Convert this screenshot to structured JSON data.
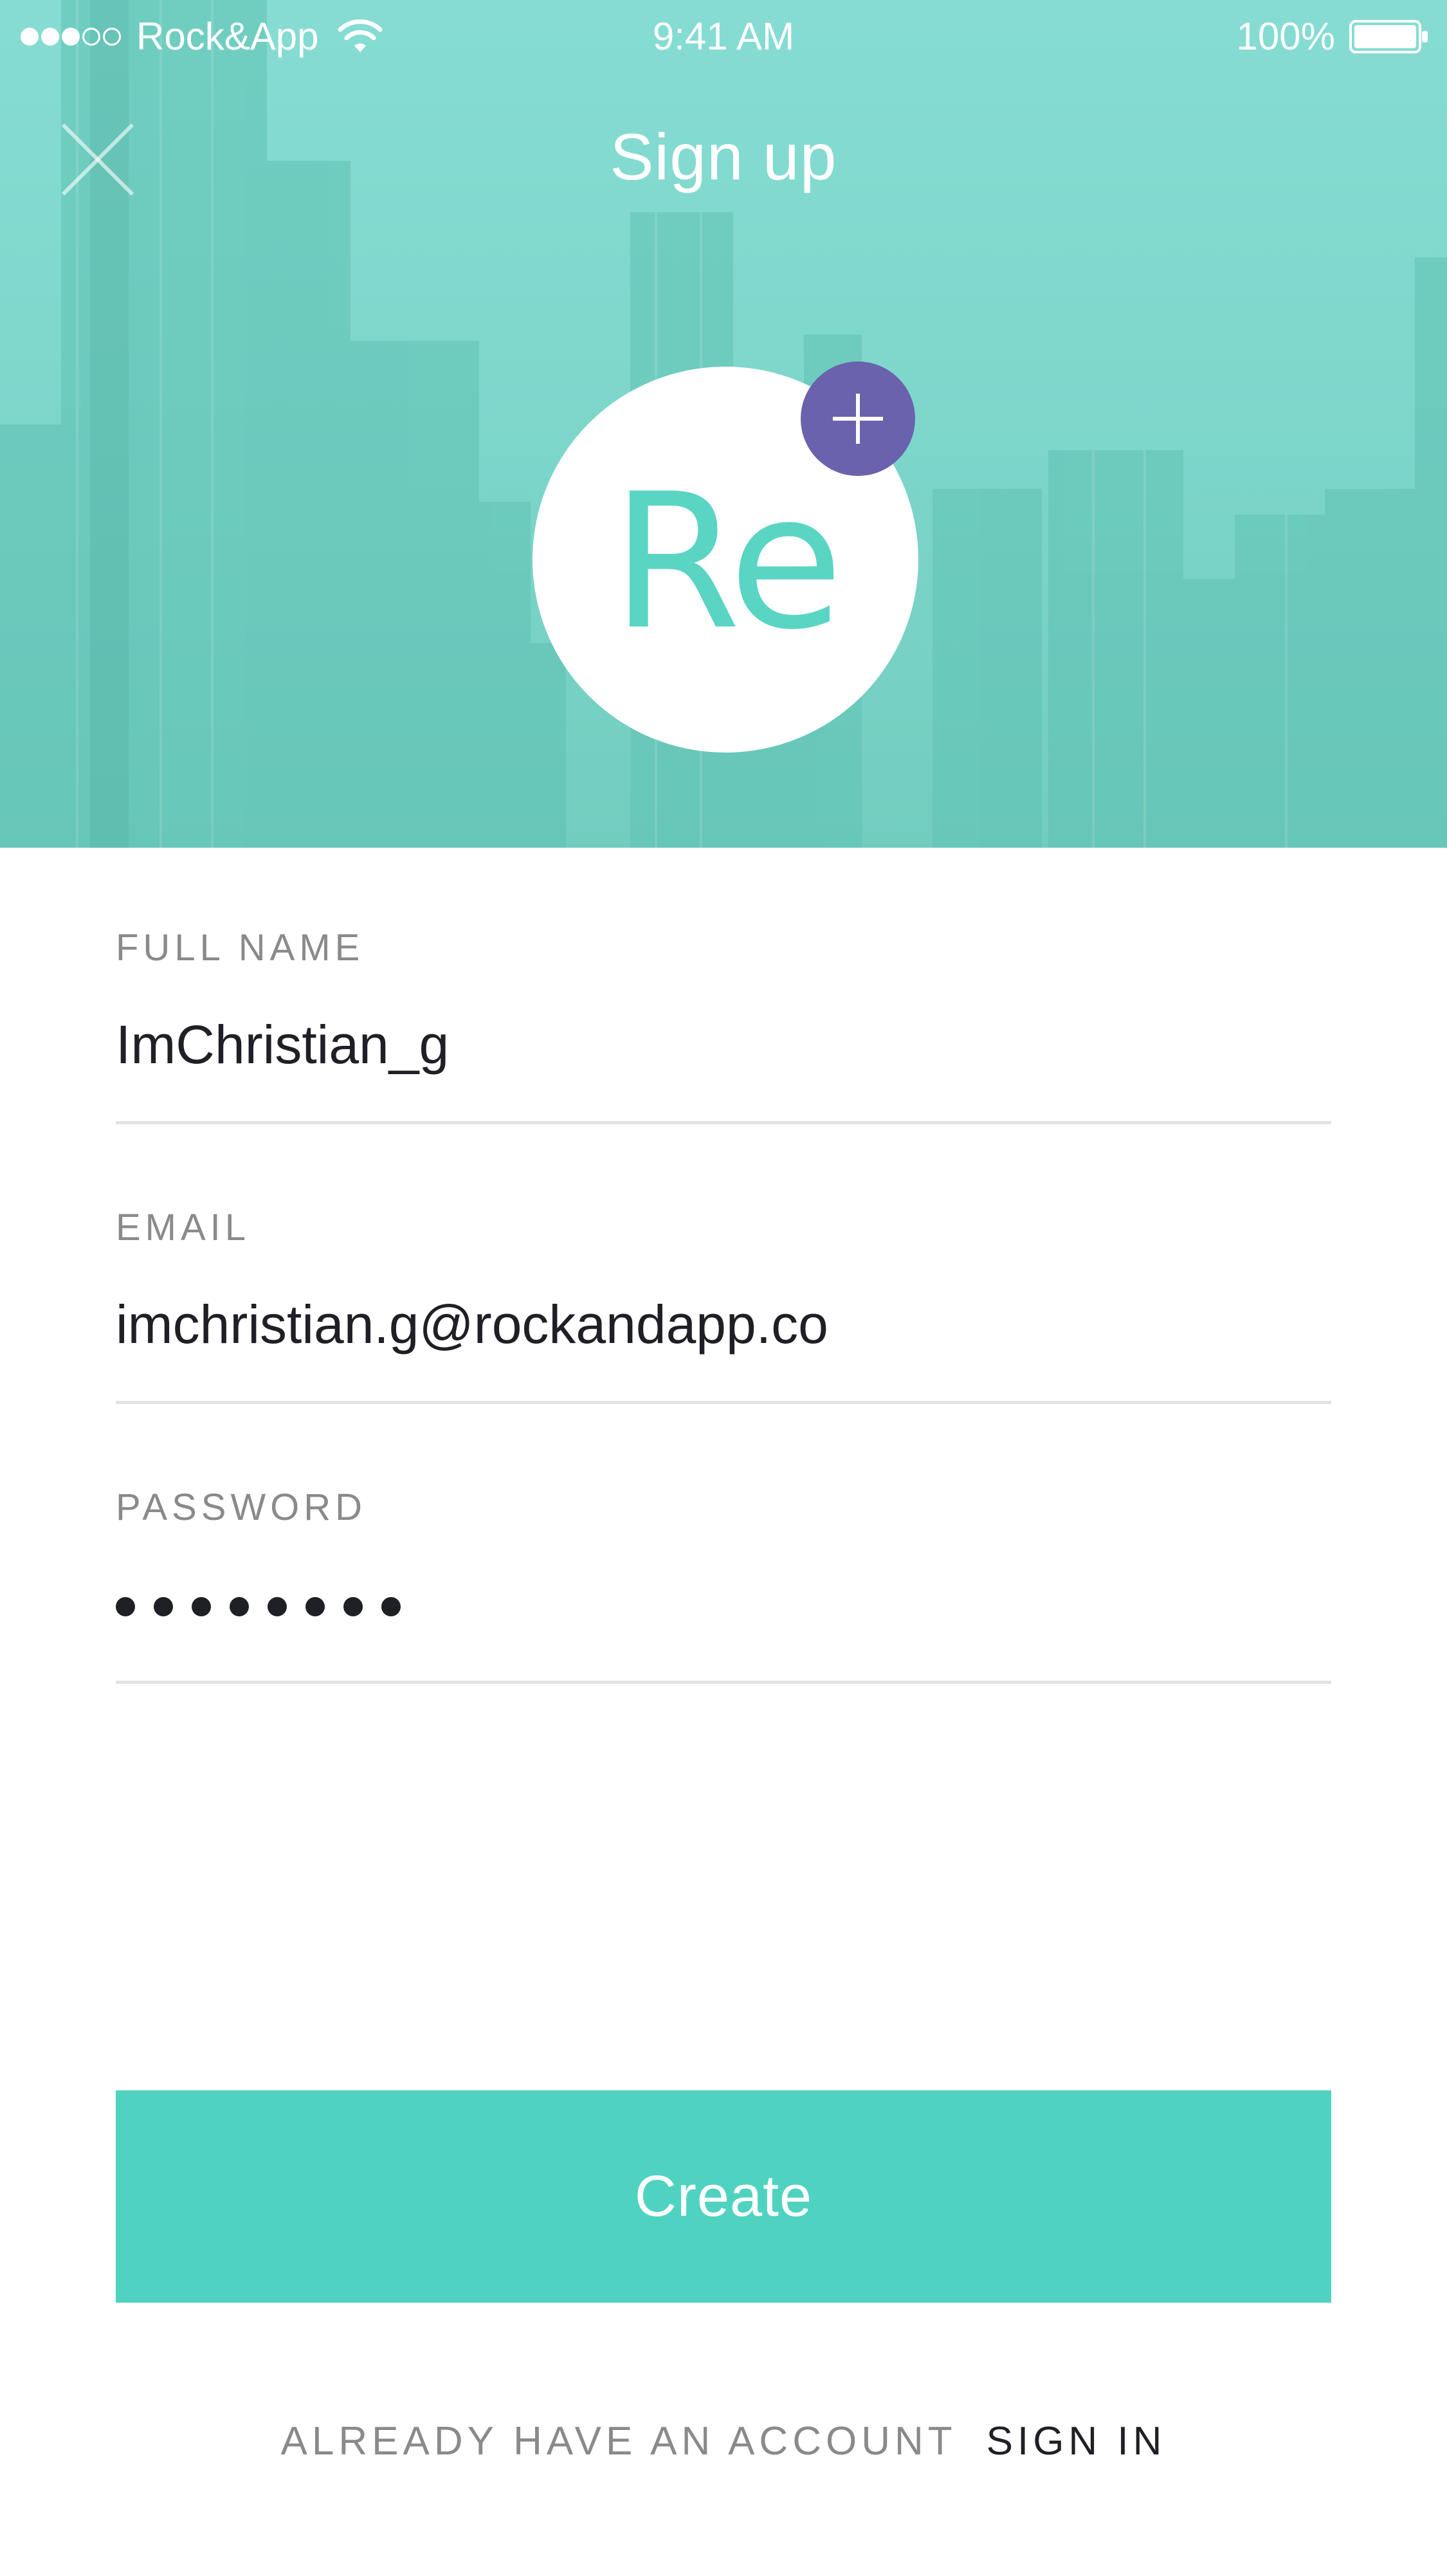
{
  "status_bar": {
    "carrier": "Rock&App",
    "time": "9:41 AM",
    "battery": "100%",
    "signal_bars_filled": 3,
    "signal_bars_total": 5
  },
  "nav": {
    "title": "Sign up",
    "close_icon": "close-icon"
  },
  "avatar": {
    "initials": "Re",
    "add_icon": "plus-icon"
  },
  "form": {
    "full_name": {
      "label": "FULL NAME",
      "value": "ImChristian_g"
    },
    "email": {
      "label": "EMAIL",
      "value": "imchristian.g@rockandapp.co"
    },
    "password": {
      "label": "PASSWORD",
      "masked_length": 8
    }
  },
  "actions": {
    "create_label": "Create"
  },
  "footer": {
    "question": "ALREADY HAVE AN ACCOUNT",
    "sign_in_label": "SIGN IN"
  },
  "colors": {
    "accent": "#4fd3c0",
    "purple": "#6a62ad",
    "text_dark": "#1f1f26",
    "label_gray": "#8a8a8a",
    "divider": "#e3e3e3"
  }
}
